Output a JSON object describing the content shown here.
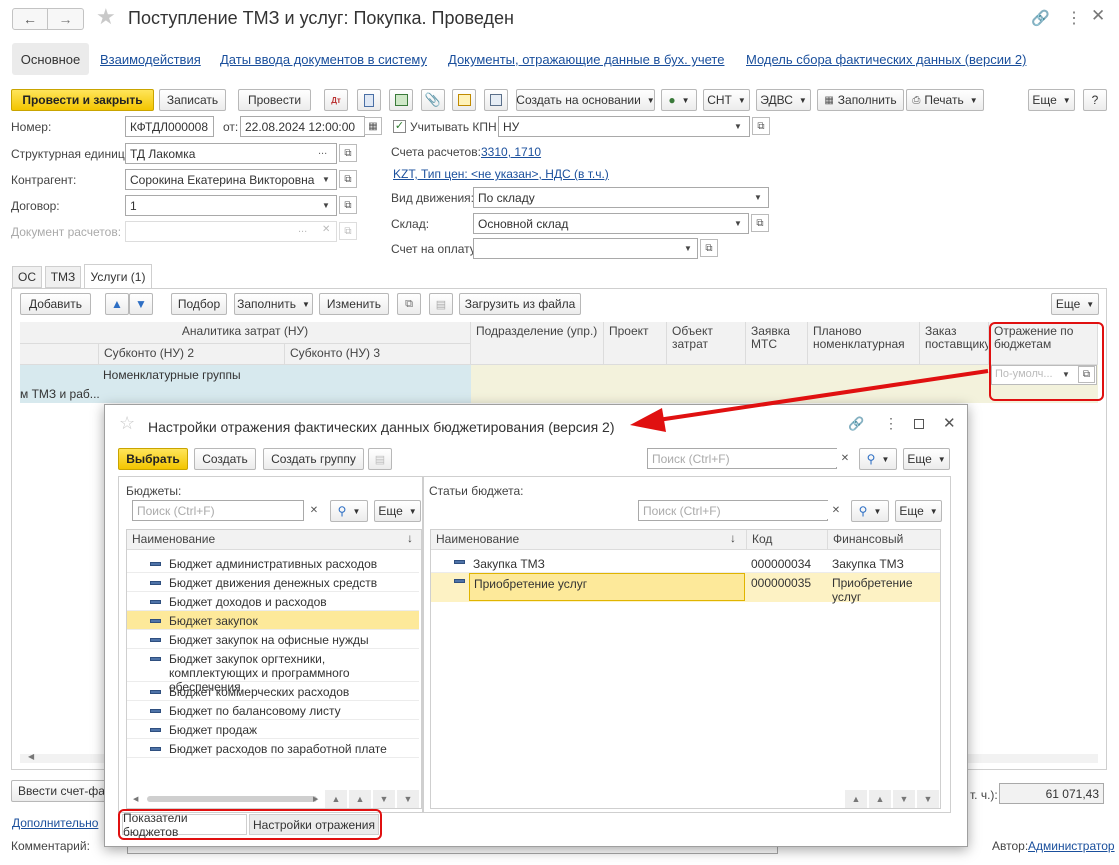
{
  "window": {
    "title": "Поступление ТМЗ и услуг: Покупка. Проведен"
  },
  "nav_tabs": [
    "Основное",
    "Взаимодействия",
    "Даты ввода документов в систему",
    "Документы, отражающие данные в бух. учете",
    "Модель сбора фактических данных (версии 2)"
  ],
  "toolbar": {
    "post_close": "Провести и закрыть",
    "save": "Записать",
    "post": "Провести",
    "create_based": "Создать на основании",
    "cnt": "СНТ",
    "edvs": "ЭДВС",
    "fill": "Заполнить",
    "print": "Печать",
    "more": "Еще"
  },
  "form": {
    "number_label": "Номер:",
    "number": "КФТДЛ000008",
    "date_label": "от:",
    "date": "22.08.2024 12:00:00",
    "kpn_label": "Учитывать КПН",
    "kpn_value": "НУ",
    "unit_label": "Структурная единица:",
    "unit": "ТД Лакомка",
    "contractor_label": "Контрагент:",
    "contractor": "Сорокина Екатерина Викторовна",
    "contract_label": "Договор:",
    "contract": "1",
    "settlement_doc_label": "Документ расчетов:",
    "accounts_label": "Счета расчетов:",
    "accounts": "3310, 1710",
    "price_link": "KZT, Тип цен: <не указан>, НДС (в т.ч.)",
    "movement_label": "Вид движения:",
    "movement": "По складу",
    "warehouse_label": "Склад:",
    "warehouse": "Основной склад",
    "invoice_label": "Счет на оплату:"
  },
  "doc_tabs": [
    "ОС",
    "ТМЗ",
    "Услуги (1)"
  ],
  "table_toolbar": {
    "add": "Добавить",
    "select": "Подбор",
    "fill": "Заполнить",
    "change": "Изменить",
    "load": "Загрузить из файла",
    "more": "Еще"
  },
  "table": {
    "group_header": "Аналитика затрат (НУ)",
    "sub2": "Субконто (НУ) 2",
    "sub3": "Субконто (НУ) 3",
    "dept": "Подразделение (упр.)",
    "project": "Проект",
    "cost_object": "Объект затрат",
    "request": "Заявка МТС",
    "planned": "Планово номенклатурная",
    "supplier_order": "Заказ поставщику",
    "budget_reflection": "Отражение по бюджетам",
    "row_sub2": "Номенклатурные группы",
    "row_left": "м ТМЗ и раб...",
    "row_reflection": "По-умолч..."
  },
  "bottom": {
    "invoice_btn": "Ввести счет-фак",
    "total_label": "т. ч.):",
    "total": "61 071,43",
    "additional": "Дополнительно",
    "comment_label": "Комментарий:",
    "author_label": "Автор:",
    "author": "Администратор"
  },
  "dialog": {
    "title": "Настройки отражения фактических данных бюджетирования (версия 2)",
    "select": "Выбрать",
    "create": "Создать",
    "create_group": "Создать группу",
    "search_placeholder": "Поиск (Ctrl+F)",
    "more": "Еще",
    "budgets_label": "Бюджеты:",
    "articles_label": "Статьи бюджета:",
    "col_name": "Наименование",
    "col_code": "Код",
    "col_fin": "Финансовый пока...",
    "budgets": [
      "Бюджет административных расходов",
      "Бюджет движения денежных средств",
      "Бюджет доходов и расходов",
      "Бюджет закупок",
      "Бюджет закупок на офисные нужды",
      "Бюджет закупок оргтехники, комплектующих и программного обеспечения",
      "Бюджет коммерческих расходов",
      "Бюджет по балансовому листу",
      "Бюджет продаж",
      "Бюджет расходов по заработной плате"
    ],
    "articles": [
      {
        "name": "Закупка ТМЗ",
        "code": "000000034",
        "fin": "Закупка ТМЗ"
      },
      {
        "name": "Приобретение услуг",
        "code": "000000035",
        "fin": "Приобретение услуг"
      }
    ],
    "bottom_tabs": [
      "Показатели бюджетов",
      "Настройки отражения"
    ]
  },
  "colors": {
    "accent_yellow": "#f3c500",
    "link": "#1a4f9c",
    "selection": "#fde99a",
    "row_blue": "#d7e9ee",
    "red": "#e01010"
  }
}
